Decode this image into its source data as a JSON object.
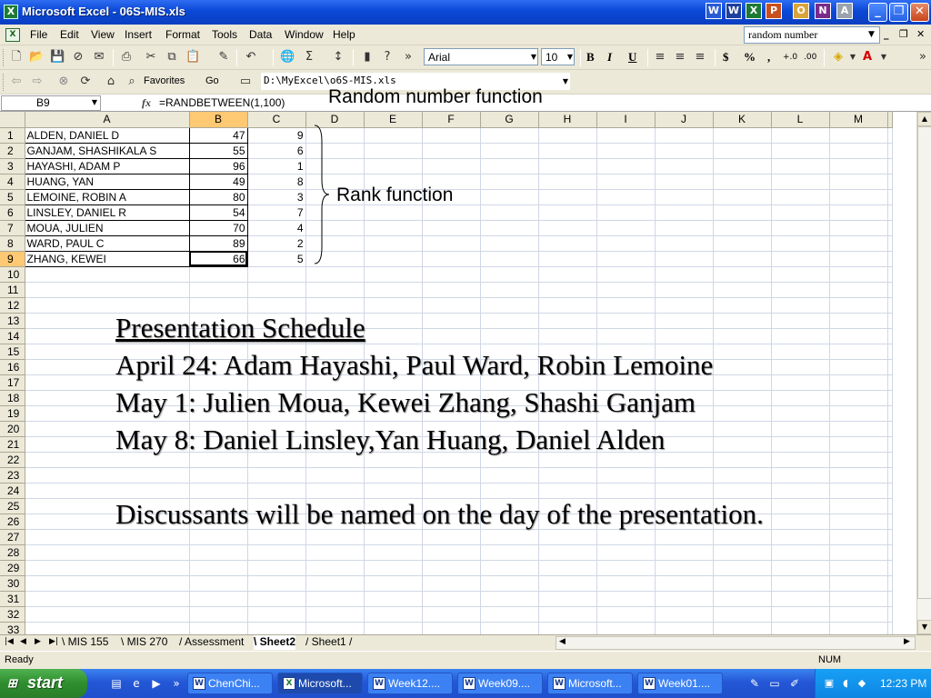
{
  "window": {
    "title": "Microsoft Excel - 06S-MIS.xls",
    "app_icon": "excel-icon",
    "title_app_icons": [
      "W",
      "X",
      "P",
      "O",
      "N",
      "A"
    ],
    "controls": {
      "minimize": "_",
      "maximize": "❐",
      "close": "✕"
    }
  },
  "menu": {
    "items": [
      "File",
      "Edit",
      "View",
      "Insert",
      "Format",
      "Tools",
      "Data",
      "Window",
      "Help"
    ],
    "help_box": "random number",
    "mdi_controls": [
      "_",
      "❐",
      "✕"
    ]
  },
  "toolbar1": {
    "icons": [
      "new-icon",
      "open-icon",
      "save-icon",
      "permission-icon",
      "email-icon",
      "print-preview-icon",
      "print-icon",
      "spelling-icon",
      "cut-icon",
      "copy-icon",
      "paste-icon",
      "format-painter-icon",
      "undo-icon",
      "insert-hyperlink-icon",
      "autosum-icon",
      "sort-ascending-icon",
      "chart-wizard-icon",
      "help-icon"
    ],
    "font_name": "Arial",
    "font_size": "10",
    "bold": "B",
    "italic": "I",
    "underline": "U",
    "currency": "$",
    "percent": "%",
    "comma": ",",
    "increase_decimal": "+.0",
    "decrease_decimal": ".00"
  },
  "toolbar2": {
    "favorites": "Favorites",
    "go": "Go",
    "address": "D:\\MyExcel\\o6S-MIS.xls"
  },
  "formula_bar": {
    "name_box": "B9",
    "fx": "fx",
    "formula": "=RANDBETWEEN(1,100)"
  },
  "sheet": {
    "columns": [
      "A",
      "B",
      "C",
      "D",
      "E",
      "F",
      "G",
      "H",
      "I",
      "J",
      "K",
      "L",
      "M"
    ],
    "selected_column": "B",
    "selected_row": 9,
    "rows": [
      {
        "name": "ALDEN, DANIEL D",
        "random": 47,
        "rank": 9
      },
      {
        "name": "GANJAM, SHASHIKALA S",
        "random": 55,
        "rank": 6
      },
      {
        "name": "HAYASHI, ADAM P",
        "random": 96,
        "rank": 1
      },
      {
        "name": "HUANG, YAN",
        "random": 49,
        "rank": 8
      },
      {
        "name": "LEMOINE, ROBIN A",
        "random": 80,
        "rank": 3
      },
      {
        "name": "LINSLEY, DANIEL R",
        "random": 54,
        "rank": 7
      },
      {
        "name": "MOUA, JULIEN",
        "random": 70,
        "rank": 4
      },
      {
        "name": "WARD, PAUL C",
        "random": 89,
        "rank": 2
      },
      {
        "name": "ZHANG, KEWEI",
        "random": 66,
        "rank": 5
      }
    ]
  },
  "annotations": {
    "random_label": "Random number function",
    "rank_label": "Rank function"
  },
  "schedule": {
    "title": "Presentation Schedule",
    "lines": [
      "April 24: Adam Hayashi, Paul Ward, Robin Lemoine",
      "May 1: Julien Moua, Kewei Zhang, Shashi Ganjam",
      "May 8: Daniel Linsley,Yan Huang, Daniel Alden"
    ],
    "note": "Discussants will be named on the day of the presentation."
  },
  "tabs": {
    "items": [
      "MIS 155",
      "MIS 270",
      "Assessment",
      "Sheet2",
      "Sheet1"
    ],
    "active": "Sheet2"
  },
  "status": {
    "left": "Ready",
    "num": "NUM"
  },
  "taskbar": {
    "start": "start",
    "buttons": [
      {
        "label": "ChenChi...",
        "icon": "word-icon",
        "active": false
      },
      {
        "label": "Microsoft...",
        "icon": "excel-icon",
        "active": true
      },
      {
        "label": "Week12....",
        "icon": "word-icon",
        "active": false
      },
      {
        "label": "Week09....",
        "icon": "word-icon",
        "active": false
      },
      {
        "label": "Microsoft...",
        "icon": "word-icon",
        "active": false
      },
      {
        "label": "Week01....",
        "icon": "word-icon",
        "active": false
      }
    ],
    "clock": "12:23 PM"
  },
  "colors": {
    "titlebar": "#0a48d6",
    "selected_header": "#ffc873",
    "taskbar": "#2457d6",
    "start": "#2e8d2e"
  }
}
